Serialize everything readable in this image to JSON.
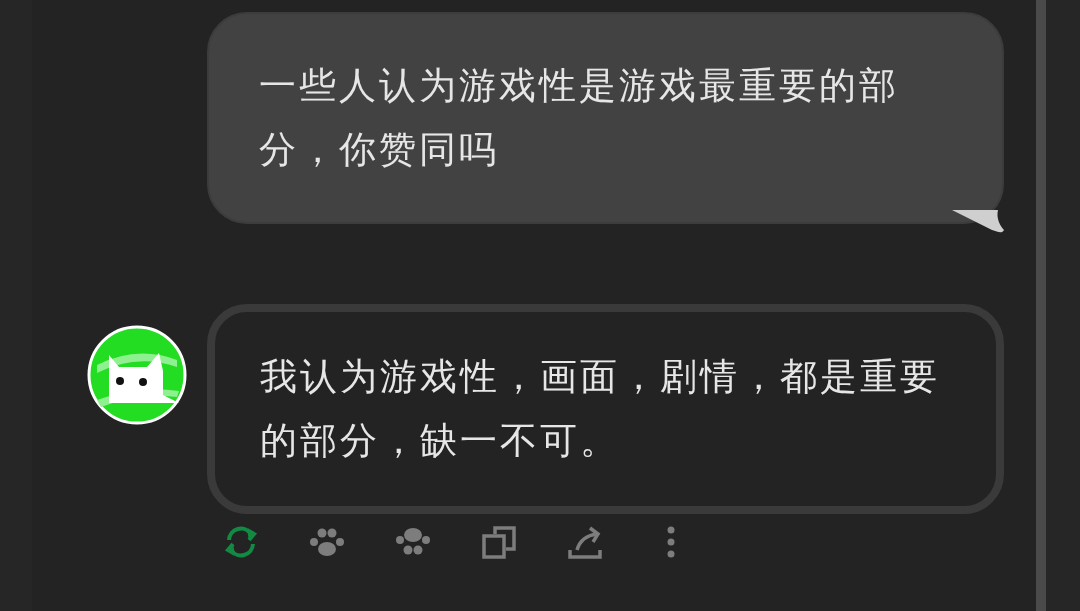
{
  "messages": [
    {
      "kind": "user",
      "text": "一些人认为游戏性是游戏最重要的部分，你赞同吗"
    },
    {
      "kind": "bot",
      "text": "我认为游戏性，画面，剧情，都是重要的部分，缺一不可。"
    }
  ]
}
